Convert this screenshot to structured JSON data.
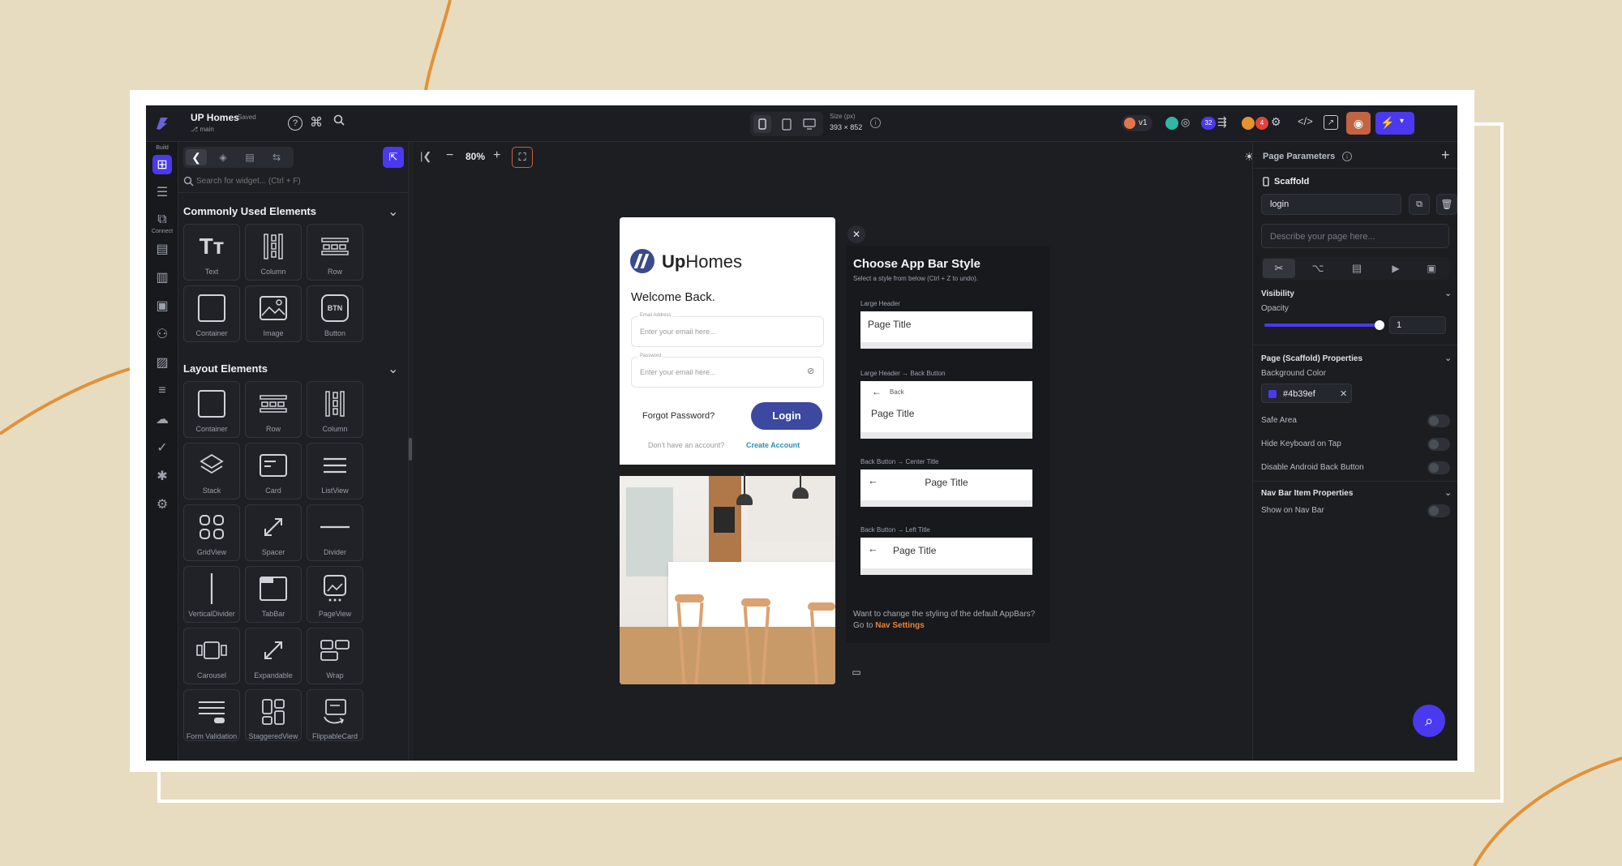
{
  "topbar": {
    "project_name": "UP Homes",
    "saved_label": "Saved",
    "branch": "main",
    "size_label": "Size (px)",
    "size_value": "393 × 852",
    "version": "v1",
    "badge_count_1": "32",
    "badge_count_2": "4"
  },
  "rail": {
    "build_label": "Build",
    "connect_label": "Connect"
  },
  "widgets": {
    "search_placeholder": "Search for widget... (Ctrl + F)",
    "common_title": "Commonly Used Elements",
    "common": [
      "Text",
      "Column",
      "Row",
      "Container",
      "Image",
      "Button"
    ],
    "layout_title": "Layout Elements",
    "layout": [
      "Container",
      "Row",
      "Column",
      "Stack",
      "Card",
      "ListView",
      "GridView",
      "Spacer",
      "Divider",
      "VerticalDivider",
      "TabBar",
      "PageView",
      "Carousel",
      "Expandable",
      "Wrap",
      "Form Validation",
      "StaggeredView",
      "FlippableCard"
    ]
  },
  "canvas": {
    "zoom": "80%"
  },
  "phone": {
    "brand_up": "Up",
    "brand_homes": "Homes",
    "welcome": "Welcome Back.",
    "email_label": "Email Address",
    "email_placeholder": "Enter your email here...",
    "password_label": "Password",
    "password_placeholder": "Enter your email here...",
    "forgot": "Forgot Password?",
    "login": "Login",
    "no_account": "Don't have an account?",
    "create_account": "Create Account",
    "accent_color": "#4b39ef"
  },
  "appbar_panel": {
    "title": "Choose App Bar Style",
    "subtitle": "Select a style from below (Ctrl + Z to undo).",
    "options": [
      {
        "label": "Large Header",
        "title": "Page Title"
      },
      {
        "label": "Large Header → Back Button",
        "back": "Back",
        "title": "Page Title"
      },
      {
        "label": "Back Button → Center Title",
        "title": "Page Title"
      },
      {
        "label": "Back Button → Left Title",
        "title": "Page Title"
      }
    ],
    "footer_text": "Want to change the styling of the default AppBars? Go to",
    "footer_link": "Nav Settings"
  },
  "rpanel": {
    "title": "Page Parameters",
    "scaffold": "Scaffold",
    "page_name": "login",
    "desc_placeholder": "Describe your page here...",
    "visibility": "Visibility",
    "opacity": "Opacity",
    "opacity_value": "1",
    "opacity_level": 1,
    "props_title": "Page (Scaffold) Properties",
    "bg_color_label": "Background Color",
    "bg_color_value": "#4b39ef",
    "safe_area": "Safe Area",
    "hide_keyboard": "Hide Keyboard on Tap",
    "disable_back": "Disable Android Back Button",
    "nav_title": "Nav Bar Item Properties",
    "show_nav": "Show on Nav Bar"
  }
}
